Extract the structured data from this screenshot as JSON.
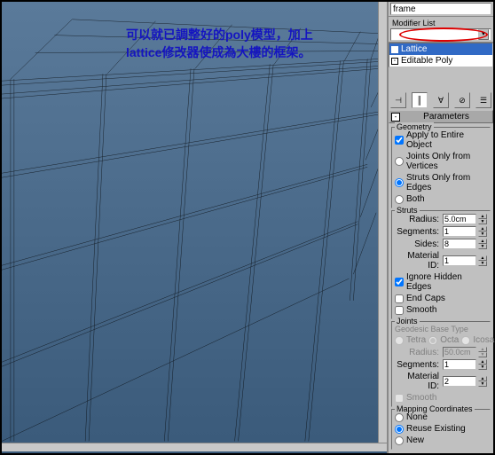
{
  "viewport": {
    "annotation_line1_a": "可以就已調整好的",
    "annotation_line1_b": "poly",
    "annotation_line1_c": "模型，加上",
    "annotation_line2_a": "lattice",
    "annotation_line2_b": "修改器使成為大樓的框架。"
  },
  "panel": {
    "frame_label": "frame",
    "modifier_list_label": "Modifier List",
    "stack": {
      "lattice": "Lattice",
      "editable_poly": "Editable Poly"
    },
    "parameters_title": "Parameters",
    "geometry": {
      "title": "Geometry",
      "apply_entire": "Apply to Entire Object",
      "joints_only": "Joints Only from Vertices",
      "struts_only": "Struts Only from Edges",
      "both": "Both"
    },
    "struts": {
      "title": "Struts",
      "radius_label": "Radius:",
      "radius_value": "5.0cm",
      "segments_label": "Segments:",
      "segments_value": "1",
      "sides_label": "Sides:",
      "sides_value": "8",
      "material_label": "Material ID:",
      "material_value": "1",
      "ignore_hidden": "Ignore Hidden Edges",
      "end_caps": "End Caps",
      "smooth": "Smooth"
    },
    "joints": {
      "title": "Joints",
      "base_type": "Geodesic Base Type",
      "tetra": "Tetra",
      "octa": "Octa",
      "icosa": "Icosa",
      "radius_label": "Radius:",
      "radius_value": "50.0cm",
      "segments_label": "Segments:",
      "segments_value": "1",
      "material_label": "Material ID:",
      "material_value": "2",
      "smooth": "Smooth"
    },
    "mapping": {
      "title": "Mapping Coordinates",
      "none": "None",
      "reuse": "Reuse Existing",
      "new": "New"
    }
  }
}
